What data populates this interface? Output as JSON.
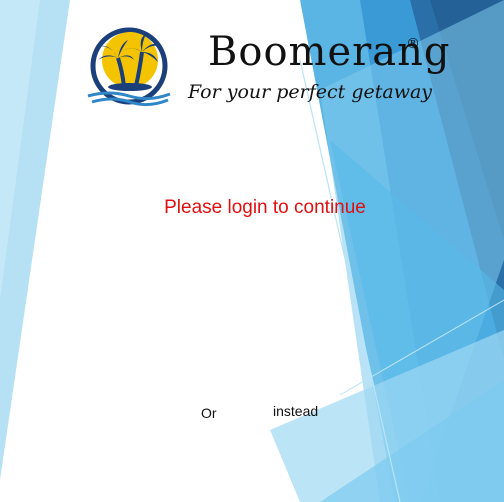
{
  "brand": {
    "name": "Boomerang",
    "registered_mark": "®",
    "tagline": "For your perfect getaway",
    "logo_icon": "palm-tree-sunset-icon"
  },
  "login": {
    "prompt": "Please login to continue",
    "or_text": "Or",
    "instead_text": "instead"
  },
  "colors": {
    "prompt": "#e01010",
    "accent_blue": "#2f87c8",
    "deep_blue": "#1f5f93",
    "light_blue": "#8fd3f2",
    "logo_sun": "#f4c400",
    "logo_navy": "#1b3f7a"
  }
}
